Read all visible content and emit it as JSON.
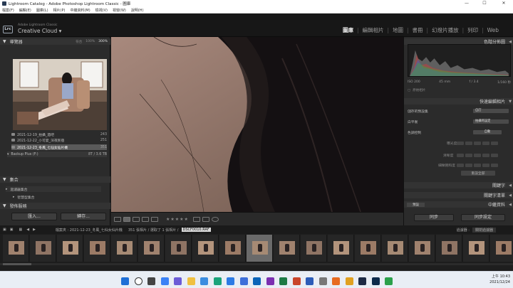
{
  "window": {
    "title": "Lightroom Catalog - Adobe Photoshop Lightroom Classic - 圖庫",
    "controls": [
      "—",
      "☐",
      "✕"
    ]
  },
  "menu": [
    "檔案(F)",
    "編輯(E)",
    "圖庫(L)",
    "相片(P)",
    "中繼資料(M)",
    "檢視(V)",
    "視窗(W)",
    "說明(H)"
  ],
  "brand": {
    "line1": "Adobe Lightroom Classic",
    "line2": "Creative Cloud",
    "logo": "Lrc"
  },
  "modules": [
    "圖庫",
    "編輯相片",
    "地圖",
    "書冊",
    "幻燈片播放",
    "列印",
    "Web"
  ],
  "active_module": "圖庫",
  "left": {
    "navigator": {
      "title": "導覽器",
      "fit": "符合",
      "zoom1": "100%",
      "zoom2": "300%"
    },
    "folders": [
      {
        "label": "2021-12-19_拍攝_酒吧",
        "count": "243"
      },
      {
        "label": "2021-12-22_小可愛_深夜民宿",
        "count": "251"
      },
      {
        "label": "2021-12-23_冬風_七仙女仙片機",
        "count": "351",
        "selected": true
      }
    ],
    "volume": {
      "label": "Backup Plus (F:)",
      "size": "8T / 3.6 TB"
    },
    "collections": {
      "title": "集合",
      "items": [
        "過濾器集合",
        "智慧型集合"
      ]
    },
    "publish": {
      "title": "發佈服務"
    },
    "import_btn": "匯入...",
    "export_btn": "轉存..."
  },
  "right": {
    "histogram": {
      "title": "色階分佈圖",
      "iso": "ISO 200",
      "focal": "45 mm",
      "aperture": "f / 3.4",
      "shutter": "1/160 秒",
      "original": "原始相片"
    },
    "quick": {
      "title": "快速編輯相片",
      "preset_label": "儲存的預設集",
      "preset_value": "自訂",
      "wb_label": "白平衡",
      "wb_value": "拍攝時設定",
      "tone_label": "色調控制",
      "tone_value": "自動",
      "exposure": "曝光度",
      "clarity": "清晰度",
      "vibrance": "細緻飽和度",
      "reset": "重設全部"
    },
    "keywords": "關鍵字",
    "keyword_list": "關鍵字清單",
    "metadata": {
      "title": "中繼資料",
      "value": "預設"
    },
    "sync_btn": "同步",
    "sync_settings_btn": "同步設定"
  },
  "filmstrip": {
    "path": "檔案夾 : 2021-12-23_冬風_七仙女仙片機",
    "count": "351 張相片 / 選取了 1 張相片 /",
    "file": "DSCF0010.RAF",
    "filter_label": "過濾器 :",
    "filter_value": "關閉過濾器",
    "thumbs": 19,
    "selected_index": 9
  },
  "toolbar": {
    "stars": "★★★★★"
  },
  "taskbar": {
    "time": "上午 10:43",
    "date": "2021/12/24"
  },
  "colors": {
    "panel": "#2b2b2b",
    "header": "#333333",
    "bg": "#1e1e1e",
    "accent": "#f0f0f0"
  }
}
